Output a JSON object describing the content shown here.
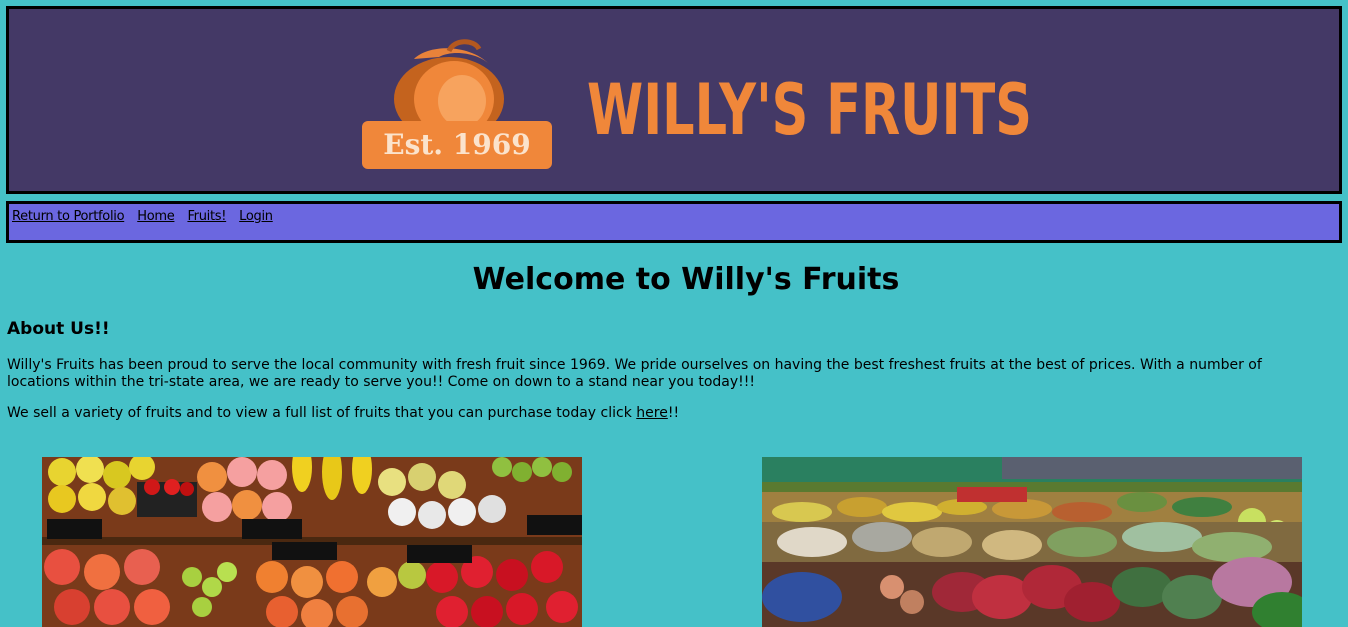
{
  "banner": {
    "logo_est": "Est. 1969",
    "logo_title": "WILLY'S FRUITS"
  },
  "nav": {
    "items": [
      {
        "label": "Return to Portfolio"
      },
      {
        "label": "Home"
      },
      {
        "label": "Fruits!"
      },
      {
        "label": "Login"
      }
    ]
  },
  "main": {
    "title": "Welcome to Willy's Fruits",
    "about_heading": "About Us!!",
    "about_text": "Willy's Fruits has been proud to serve the local community with fresh fruit since 1969. We pride ourselves on having the best freshest fruits at the best of prices. With a number of locations within the tri-state area, we are ready to serve you!! Come on down to a stand near you today!!!",
    "list_text_before": "We sell a variety of fruits and to view a full list of fruits that you can purchase today click ",
    "list_link": "here",
    "list_text_after": "!!"
  },
  "colors": {
    "background": "#45c1c8",
    "banner": "#443966",
    "nav": "#6b67e0",
    "logo_orange": "#f0873a"
  }
}
